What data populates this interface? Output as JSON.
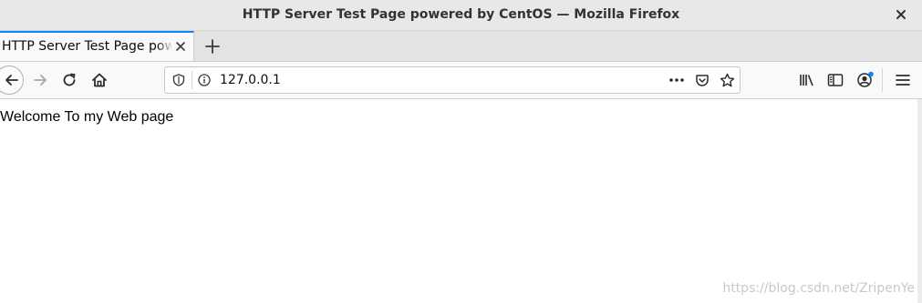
{
  "window": {
    "title": "HTTP Server Test Page powered by CentOS — Mozilla Firefox"
  },
  "tabs": [
    {
      "label": "HTTP Server Test Page powered by CentOS",
      "active": true
    }
  ],
  "navbar": {
    "url": "127.0.0.1",
    "account_badge_color": "#0a84ff"
  },
  "page": {
    "body_text": "Welcome To my Web page"
  },
  "watermark": {
    "text": "https://blog.csdn.net/ZripenYe"
  },
  "colors": {
    "accent": "#0a84ff",
    "titlebar": "#e8e8e7",
    "toolbar": "#f9f9fa"
  }
}
